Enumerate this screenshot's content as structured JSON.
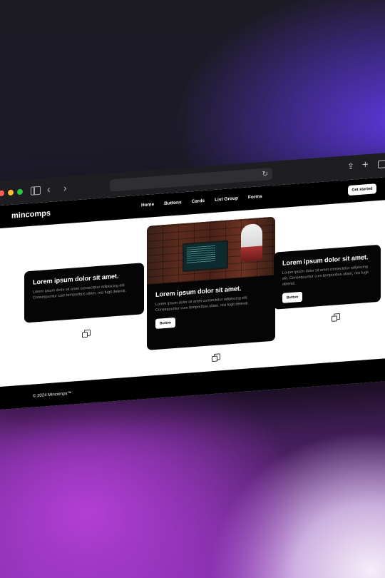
{
  "browser": {
    "window_controls": [
      "close",
      "minimize",
      "zoom"
    ],
    "icons": [
      "sidebar-icon",
      "back-icon",
      "forward-icon",
      "reload-icon",
      "share-icon",
      "new-tab-icon",
      "tab-overview-icon"
    ]
  },
  "site": {
    "brand": "mincomps",
    "nav": [
      "Home",
      "Buttons",
      "Cards",
      "List Group",
      "Forms"
    ],
    "cta": "Get started",
    "cards": [
      {
        "title": "Lorem ipsum dolor sit amet.",
        "text": "Lorem ipsum dolor sit amet consectetur adipiscing elit. Consequuntur cum temporibus ullam, nisi fugit deleniti."
      },
      {
        "title": "Lorem ipsum dolor sit amet.",
        "text": "Lorem ipsum dolor sit amet consectetur adipiscing elit. Consequuntur cum temporibus ullam, nisi fugit deleniti.",
        "button": "Button",
        "image": "laptop-on-brick-wall"
      },
      {
        "title": "Lorem ipsum dolor sit amet.",
        "text": "Lorem ipsum dolor sit amet consectetur adipiscing elit. Consequuntur cum temporibus ullam, nisi fugit deleniti.",
        "button": "Button"
      }
    ],
    "footer": "© 2024 Mincomps™"
  }
}
